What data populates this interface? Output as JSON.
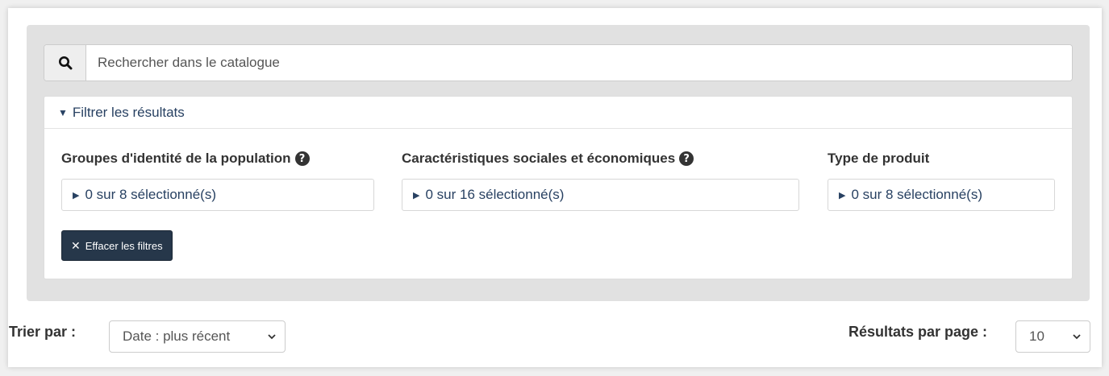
{
  "search": {
    "placeholder": "Rechercher dans le catalogue",
    "icon": "search-icon"
  },
  "filters": {
    "summary_label": "Filtrer les résultats",
    "facets": [
      {
        "title": "Groupes d'identité de la population",
        "has_help": true,
        "selection": "0 sur 8 sélectionné(s)"
      },
      {
        "title": "Caractéristiques sociales et économiques",
        "has_help": true,
        "selection": "0 sur 16 sélectionné(s)"
      },
      {
        "title": "Type de produit",
        "has_help": false,
        "selection": "0 sur 8 sélectionné(s)"
      }
    ],
    "clear_label": "Effacer les filtres"
  },
  "sort": {
    "label": "Trier par :",
    "selected": "Date : plus récent"
  },
  "per_page": {
    "label": "Résultats par page :",
    "selected": "10"
  },
  "colors": {
    "link_blue": "#284162",
    "button_dark": "#26374a",
    "well_gray": "#e1e1e1"
  }
}
